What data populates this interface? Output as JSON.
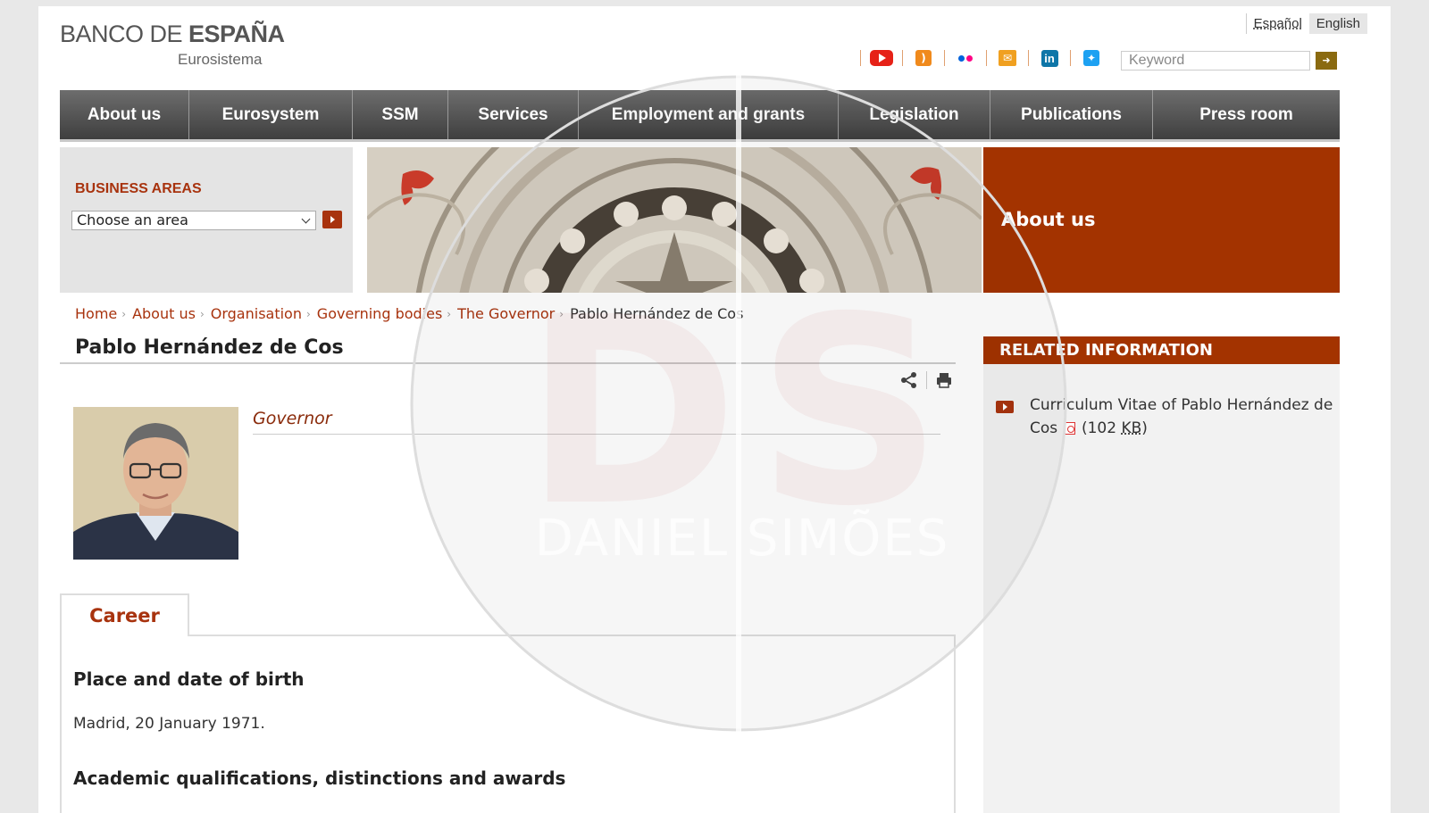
{
  "header": {
    "logo_part1": "BANCO DE ",
    "logo_part2": "ESPAÑA",
    "logo_sub": "Eurosistema",
    "languages": [
      "Español",
      "English"
    ],
    "search_placeholder": "Keyword",
    "social_icons": [
      "youtube-icon",
      "rss-icon",
      "flickr-icon",
      "mail-icon",
      "linkedin-icon",
      "twitter-icon"
    ]
  },
  "nav": {
    "items": [
      "About us",
      "Eurosystem",
      "SSM",
      "Services",
      "Employment and grants",
      "Legislation",
      "Publications",
      "Press room"
    ]
  },
  "banner": {
    "areas_title": "BUSINESS AREAS",
    "areas_select": "Choose an area",
    "section_title": "About us"
  },
  "breadcrumb": [
    "Home",
    "About us",
    "Organisation",
    "Governing bodies",
    "The Governor",
    "Pablo Hernández de Cos"
  ],
  "profile": {
    "name": "Pablo Hernández de Cos",
    "role": "Governor"
  },
  "career": {
    "tab_label": "Career",
    "sections": [
      {
        "heading": "Place and date of birth",
        "text": "Madrid, 20 January 1971."
      },
      {
        "heading": "Academic qualifications, distinctions and awards",
        "text": ""
      }
    ]
  },
  "related": {
    "heading": "RELATED INFORMATION",
    "item_text": "Curriculum Vitae of Pablo Hernández de Cos",
    "item_size_prefix": "(102 ",
    "item_size_unit": "KB",
    "item_size_suffix": ")"
  },
  "watermark": {
    "line1": "DS",
    "line2": "DANIEL SIMÕES"
  },
  "colors": {
    "accent": "#a33300",
    "link": "#a8330e",
    "nav_top": "#6d6d6d",
    "nav_bottom": "#3f3f3f"
  }
}
